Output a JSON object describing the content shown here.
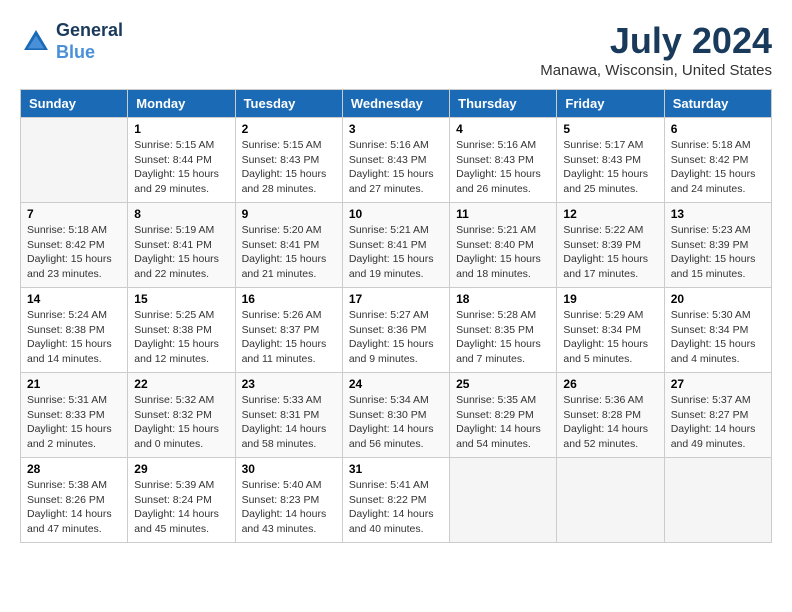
{
  "header": {
    "logo_line1": "General",
    "logo_line2": "Blue",
    "month": "July 2024",
    "location": "Manawa, Wisconsin, United States"
  },
  "days_of_week": [
    "Sunday",
    "Monday",
    "Tuesday",
    "Wednesday",
    "Thursday",
    "Friday",
    "Saturday"
  ],
  "weeks": [
    [
      {
        "day": "",
        "info": ""
      },
      {
        "day": "1",
        "info": "Sunrise: 5:15 AM\nSunset: 8:44 PM\nDaylight: 15 hours\nand 29 minutes."
      },
      {
        "day": "2",
        "info": "Sunrise: 5:15 AM\nSunset: 8:43 PM\nDaylight: 15 hours\nand 28 minutes."
      },
      {
        "day": "3",
        "info": "Sunrise: 5:16 AM\nSunset: 8:43 PM\nDaylight: 15 hours\nand 27 minutes."
      },
      {
        "day": "4",
        "info": "Sunrise: 5:16 AM\nSunset: 8:43 PM\nDaylight: 15 hours\nand 26 minutes."
      },
      {
        "day": "5",
        "info": "Sunrise: 5:17 AM\nSunset: 8:43 PM\nDaylight: 15 hours\nand 25 minutes."
      },
      {
        "day": "6",
        "info": "Sunrise: 5:18 AM\nSunset: 8:42 PM\nDaylight: 15 hours\nand 24 minutes."
      }
    ],
    [
      {
        "day": "7",
        "info": "Sunrise: 5:18 AM\nSunset: 8:42 PM\nDaylight: 15 hours\nand 23 minutes."
      },
      {
        "day": "8",
        "info": "Sunrise: 5:19 AM\nSunset: 8:41 PM\nDaylight: 15 hours\nand 22 minutes."
      },
      {
        "day": "9",
        "info": "Sunrise: 5:20 AM\nSunset: 8:41 PM\nDaylight: 15 hours\nand 21 minutes."
      },
      {
        "day": "10",
        "info": "Sunrise: 5:21 AM\nSunset: 8:41 PM\nDaylight: 15 hours\nand 19 minutes."
      },
      {
        "day": "11",
        "info": "Sunrise: 5:21 AM\nSunset: 8:40 PM\nDaylight: 15 hours\nand 18 minutes."
      },
      {
        "day": "12",
        "info": "Sunrise: 5:22 AM\nSunset: 8:39 PM\nDaylight: 15 hours\nand 17 minutes."
      },
      {
        "day": "13",
        "info": "Sunrise: 5:23 AM\nSunset: 8:39 PM\nDaylight: 15 hours\nand 15 minutes."
      }
    ],
    [
      {
        "day": "14",
        "info": "Sunrise: 5:24 AM\nSunset: 8:38 PM\nDaylight: 15 hours\nand 14 minutes."
      },
      {
        "day": "15",
        "info": "Sunrise: 5:25 AM\nSunset: 8:38 PM\nDaylight: 15 hours\nand 12 minutes."
      },
      {
        "day": "16",
        "info": "Sunrise: 5:26 AM\nSunset: 8:37 PM\nDaylight: 15 hours\nand 11 minutes."
      },
      {
        "day": "17",
        "info": "Sunrise: 5:27 AM\nSunset: 8:36 PM\nDaylight: 15 hours\nand 9 minutes."
      },
      {
        "day": "18",
        "info": "Sunrise: 5:28 AM\nSunset: 8:35 PM\nDaylight: 15 hours\nand 7 minutes."
      },
      {
        "day": "19",
        "info": "Sunrise: 5:29 AM\nSunset: 8:34 PM\nDaylight: 15 hours\nand 5 minutes."
      },
      {
        "day": "20",
        "info": "Sunrise: 5:30 AM\nSunset: 8:34 PM\nDaylight: 15 hours\nand 4 minutes."
      }
    ],
    [
      {
        "day": "21",
        "info": "Sunrise: 5:31 AM\nSunset: 8:33 PM\nDaylight: 15 hours\nand 2 minutes."
      },
      {
        "day": "22",
        "info": "Sunrise: 5:32 AM\nSunset: 8:32 PM\nDaylight: 15 hours\nand 0 minutes."
      },
      {
        "day": "23",
        "info": "Sunrise: 5:33 AM\nSunset: 8:31 PM\nDaylight: 14 hours\nand 58 minutes."
      },
      {
        "day": "24",
        "info": "Sunrise: 5:34 AM\nSunset: 8:30 PM\nDaylight: 14 hours\nand 56 minutes."
      },
      {
        "day": "25",
        "info": "Sunrise: 5:35 AM\nSunset: 8:29 PM\nDaylight: 14 hours\nand 54 minutes."
      },
      {
        "day": "26",
        "info": "Sunrise: 5:36 AM\nSunset: 8:28 PM\nDaylight: 14 hours\nand 52 minutes."
      },
      {
        "day": "27",
        "info": "Sunrise: 5:37 AM\nSunset: 8:27 PM\nDaylight: 14 hours\nand 49 minutes."
      }
    ],
    [
      {
        "day": "28",
        "info": "Sunrise: 5:38 AM\nSunset: 8:26 PM\nDaylight: 14 hours\nand 47 minutes."
      },
      {
        "day": "29",
        "info": "Sunrise: 5:39 AM\nSunset: 8:24 PM\nDaylight: 14 hours\nand 45 minutes."
      },
      {
        "day": "30",
        "info": "Sunrise: 5:40 AM\nSunset: 8:23 PM\nDaylight: 14 hours\nand 43 minutes."
      },
      {
        "day": "31",
        "info": "Sunrise: 5:41 AM\nSunset: 8:22 PM\nDaylight: 14 hours\nand 40 minutes."
      },
      {
        "day": "",
        "info": ""
      },
      {
        "day": "",
        "info": ""
      },
      {
        "day": "",
        "info": ""
      }
    ]
  ]
}
